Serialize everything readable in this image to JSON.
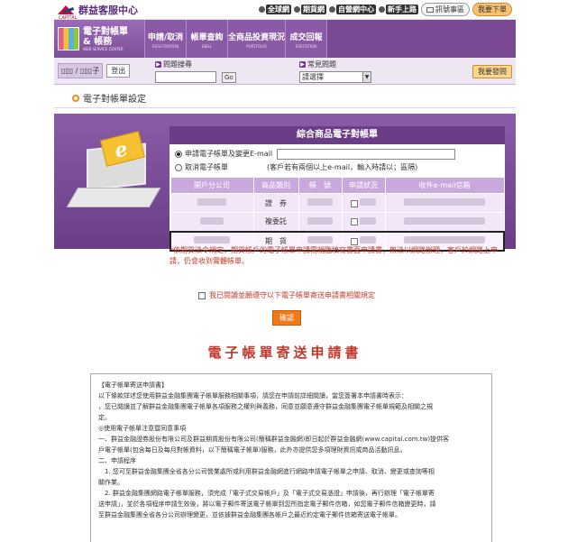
{
  "header": {
    "brand": "群益客服中心",
    "brand_sub": "CAPITAL",
    "links": [
      "全球網",
      "期貨網",
      "自營網中心",
      "新手上路"
    ],
    "message_label": "訊號事區",
    "download_label": "我要下單"
  },
  "nav": {
    "brand_l1": "電子對帳單",
    "brand_l2": "& 帳務",
    "brand_en": "WEB SERVICE CENTER",
    "items": [
      {
        "label": "申請/取消",
        "en": "REGISTRATION"
      },
      {
        "label": "帳單查詢",
        "en": "EBILL"
      },
      {
        "label": "全商品投資現況",
        "en": "PORTFOLIO"
      },
      {
        "label": "成交回報",
        "en": "EXECUTION"
      }
    ]
  },
  "search": {
    "user": "▯▯▯ /  ▯▯▯子",
    "logout": "登出",
    "question_label": "問題搜尋",
    "go_label": "Go",
    "faq_label": "常見問題",
    "faq_selected": "請選擇",
    "ask_label": "我要發問"
  },
  "page_title": "電子對帳單設定",
  "card": {
    "title": "綜合商品電子對帳單",
    "opt_apply": "申請電子帳單及變更E-mail",
    "opt_cancel": "取消電子帳單",
    "note": "(客戶若有兩個以上e-mail，輸入時請以；區隔)",
    "columns": [
      "開戶分公司",
      "商品類別",
      "帳　號",
      "申請狀況",
      "收件e-mail信箱"
    ],
    "rows": [
      {
        "product": "證　券"
      },
      {
        "product": "複委託"
      },
      {
        "product": "期　貨"
      }
    ]
  },
  "warning": "*依期貨法令規定，期貨帳戶的電子帳單申請需親臨填寫書面申請書，無法以網路辦理，客戶於網路上申請，仍會收到實體帳單。",
  "agree_label": "我已閱讀並願遵守以下電子帳單寄送申請書相關規定",
  "confirm_label": "確認",
  "doc_title": "電子帳單寄送申請書",
  "terms": [
    "【電子帳單寄送申請書】",
    "以下條款詳述您使用群益金融集團電子帳單服務相關事項，請您在申請前詳細閱讀，當您簽署本申請書時表示：",
    "，您已閱讀並了解群益金融集團電子帳單各項服務之權利與義務，同意並願意遵守群益金融集團電子帳單規範及相關之規",
    "定。",
    "◎使用電子帳單注意暨同意事項",
    "一、群益金融證券股份有限公司及群益期貨股份有限公司(簡稱群益金融網)即日起於群益金融網(www.capital.com.tw)提供客",
    "戶電子帳單(包含每日及每月對帳資料，以下簡稱電子帳單)服務，此外亦提供您多項理財資訊或商品活動訊息。",
    "二、申請程序",
    "　1. 您可至群益金融集團全省各分公司營業處所或利用群益金融網進行網路申請電子帳單之申請、取消、變更或查詢等相",
    "關作業。",
    "　2. 群益金融集團網路電子帳單服務，須完成「電子式交易帳戶」及「電子式交易憑證」申請後，再行辦理「電子帳單寄",
    "送申請」，並於各項程序申請生效後，將以電子郵件寄送電子帳單到您所指定電子郵件信箱，如您電子郵件信箱變更時，請",
    "至群益金融集團全省各分公司辦理變更，並依據群益金融集團各帳戶之最近約定電子郵件信箱寄送電子帳單。"
  ]
}
